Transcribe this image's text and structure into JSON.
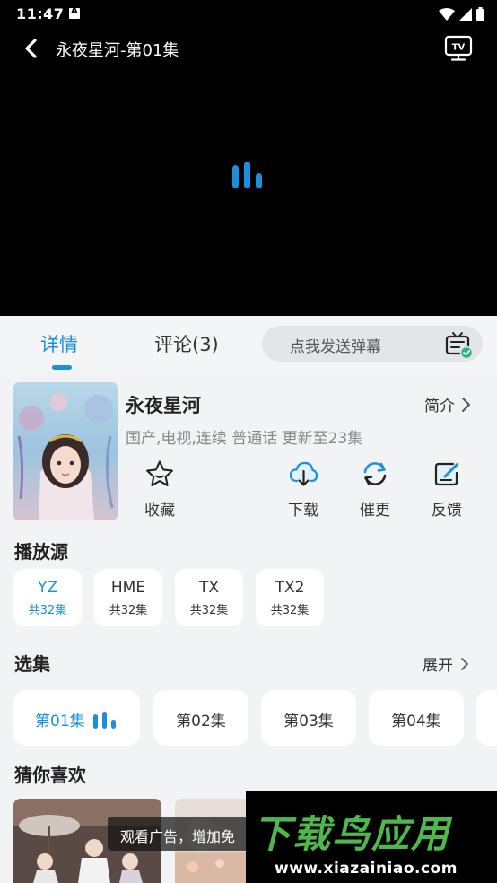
{
  "status_bar": {
    "time": "11:47"
  },
  "player": {
    "title": "永夜星河-第01集",
    "tv_icon_text": "TV"
  },
  "tabs": {
    "details": "详情",
    "comments": "评论(3)"
  },
  "danmaku": {
    "placeholder": "点我发送弹幕"
  },
  "show": {
    "title": "永夜星河",
    "intro_label": "简介",
    "meta": "国产,电视,连续 普通话 更新至23集"
  },
  "actions": {
    "favorite": "收藏",
    "download": "下载",
    "urge": "催更",
    "feedback": "反馈"
  },
  "sources": {
    "title": "播放源",
    "items": [
      {
        "name": "YZ",
        "count": "共32集"
      },
      {
        "name": "HME",
        "count": "共32集"
      },
      {
        "name": "TX",
        "count": "共32集"
      },
      {
        "name": "TX2",
        "count": "共32集"
      }
    ]
  },
  "episodes": {
    "title": "选集",
    "expand_label": "展开",
    "items": [
      "第01集",
      "第02集",
      "第03集",
      "第04集"
    ]
  },
  "recommend": {
    "title": "猜你喜欢",
    "ad_tip": "观看广告，增加免"
  },
  "watermark": {
    "main": "下载鸟应用",
    "url": "www.xiazainiao.com"
  },
  "colors": {
    "accent": "#1a8fe0",
    "player_bg": "#000000",
    "page_bg": "#f2f3f5",
    "watermark_green": "#4eb84c"
  }
}
